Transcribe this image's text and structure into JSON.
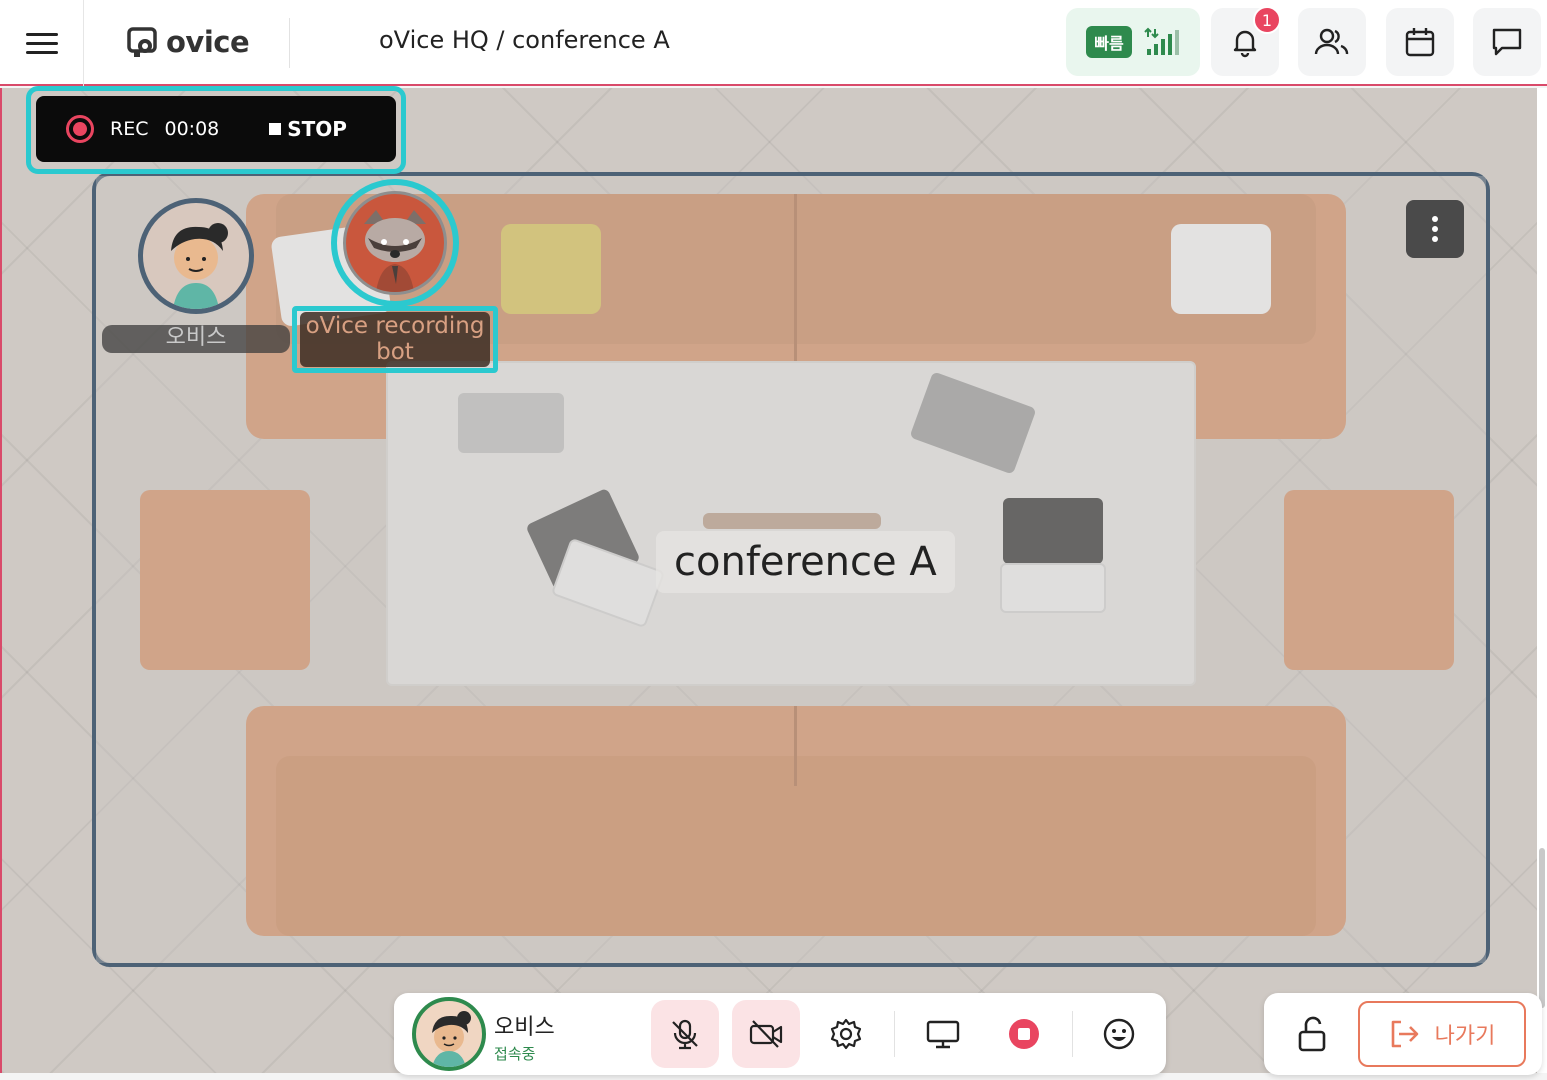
{
  "header": {
    "logo_text": "ovice",
    "breadcrumb": "oVice HQ / conference A",
    "network_label": "빠름",
    "notification_count": "1",
    "colors": {
      "accent_border": "#d94a6a",
      "network_green": "#2e8a4d",
      "badge_red": "#e94560"
    },
    "icons": [
      "menu-icon",
      "signal-icon",
      "bell-icon",
      "people-icon",
      "calendar-icon",
      "chat-icon"
    ]
  },
  "recording": {
    "label": "REC",
    "elapsed": "00:08",
    "stop_label": "STOP",
    "highlight_color": "#2bc9cf"
  },
  "space": {
    "room_name": "conference A",
    "avatars": [
      {
        "name": "오비스"
      },
      {
        "name": "oVice recording bot"
      }
    ]
  },
  "dock": {
    "user_name": "오비스",
    "user_status": "접속중",
    "buttons": [
      "mic-off-icon",
      "camera-off-icon",
      "settings-icon",
      "screen-share-icon",
      "record-icon",
      "emoji-icon"
    ]
  },
  "exit": {
    "leave_label": "나가기",
    "icons": [
      "unlock-icon",
      "exit-icon"
    ]
  }
}
